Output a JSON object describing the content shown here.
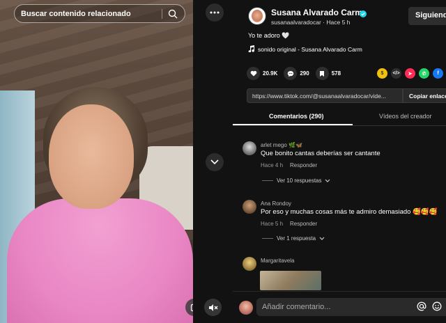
{
  "search": {
    "placeholder": "Buscar contenido relacionado"
  },
  "author": {
    "name": "Susana Alvarado Carm",
    "handle_time": "susanaalvaradocar · Hace 5 h",
    "follow_label": "Siguiendo"
  },
  "post": {
    "description": "Yo te adoro 🤍",
    "sound": "sonido original - Susana Alvarado Carm"
  },
  "stats": {
    "likes": "20.9K",
    "comments": "290",
    "saves": "578"
  },
  "share": {
    "url": "https://www.tiktok.com/@susanaalvaradocar/vide...",
    "copy_label": "Copiar enlace"
  },
  "tabs": {
    "comments": "Comentarios (290)",
    "creator_videos": "Vídeos del creador"
  },
  "comments": [
    {
      "user": "arlet mego 🌿🦋",
      "text": "Que bonito cantas deberías ser cantante",
      "time": "Hace 4 h",
      "reply_label": "Responder",
      "replies": "Ver 10 respuestas"
    },
    {
      "user": "Ana Rondoy",
      "text": "Por eso y muchas cosas más te admiro demasiado 🥰🥰🥰",
      "time": "Hace 5 h",
      "reply_label": "Responder",
      "replies": "Ver 1 respuesta"
    },
    {
      "user": "Margaritavela"
    }
  ],
  "composer": {
    "placeholder": "Añadir comentario..."
  },
  "colors": {
    "background": "#121212",
    "accent_verified": "#20d5ec",
    "pink_outfit": "#e986c4"
  }
}
